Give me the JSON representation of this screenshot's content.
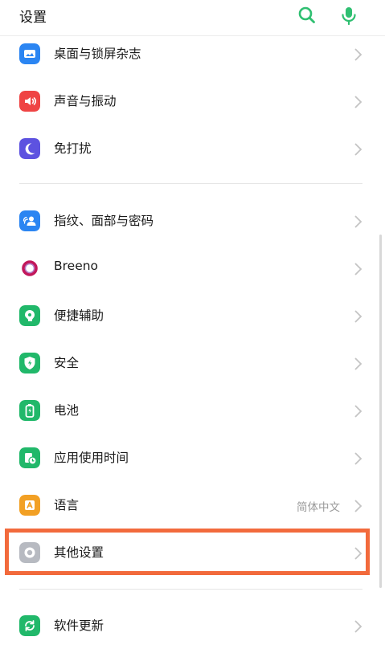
{
  "header": {
    "title": "设置",
    "search_icon": "search-icon",
    "mic_icon": "microphone-icon"
  },
  "colors": {
    "accent": "#2fbf71",
    "highlight": "#f26a3c",
    "chevron": "#c4c4c4"
  },
  "settings": {
    "items": [
      {
        "label": "桌面与锁屏杂志",
        "icon": "wallpaper-icon",
        "color": "#2b85f2"
      },
      {
        "label": "声音与振动",
        "icon": "sound-icon",
        "color": "#ef4444"
      },
      {
        "label": "免打扰",
        "icon": "moon-icon",
        "color": "#5d52e0"
      },
      {
        "label": "指纹、面部与密码",
        "icon": "fingerprint-face-icon",
        "color": "#2b85f2"
      },
      {
        "label": "Breeno",
        "icon": "breeno-icon",
        "color": "#c2185b"
      },
      {
        "label": "便捷辅助",
        "icon": "assist-icon",
        "color": "#21b86a"
      },
      {
        "label": "安全",
        "icon": "shield-icon",
        "color": "#21b86a"
      },
      {
        "label": "电池",
        "icon": "battery-icon",
        "color": "#21b86a"
      },
      {
        "label": "应用使用时间",
        "icon": "app-time-icon",
        "color": "#21b86a"
      },
      {
        "label": "语言",
        "value": "简体中文",
        "icon": "language-icon",
        "color": "#f2a024"
      },
      {
        "label": "其他设置",
        "icon": "other-settings-icon",
        "color": "#b7bac1"
      },
      {
        "label": "软件更新",
        "icon": "software-update-icon",
        "color": "#21b86a"
      }
    ]
  }
}
